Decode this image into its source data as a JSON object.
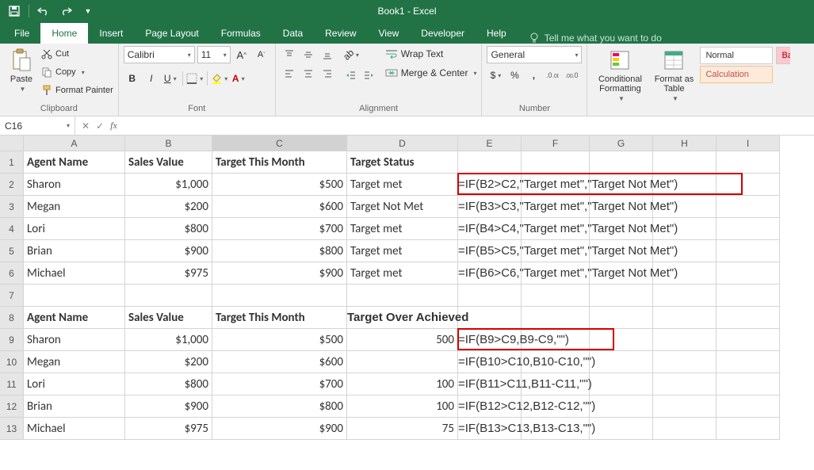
{
  "title": "Book1 - Excel",
  "tabs": [
    "File",
    "Home",
    "Insert",
    "Page Layout",
    "Formulas",
    "Data",
    "Review",
    "View",
    "Developer",
    "Help"
  ],
  "tellme": "Tell me what you want to do",
  "clipboard": {
    "cut": "Cut",
    "copy": "Copy",
    "painter": "Format Painter",
    "paste": "Paste",
    "label": "Clipboard"
  },
  "font": {
    "name": "Calibri",
    "size": "11",
    "label": "Font"
  },
  "alignment": {
    "wrap": "Wrap Text",
    "merge": "Merge & Center",
    "label": "Alignment"
  },
  "number": {
    "format": "General",
    "label": "Number"
  },
  "styles": {
    "cond": "Conditional Formatting",
    "table": "Format as Table",
    "normal": "Normal",
    "calc": "Calculation",
    "bad": "Ba"
  },
  "namebox": "C16",
  "chart_data": {
    "type": "table",
    "columns": [
      "",
      "A",
      "B",
      "C",
      "D",
      "E",
      "F",
      "G",
      "H",
      "I"
    ],
    "rows": [
      {
        "n": "1",
        "A": "Agent Name",
        "B": "Sales Value",
        "C": "Target This Month",
        "D": "Target Status",
        "E": "",
        "bold": true
      },
      {
        "n": "2",
        "A": "Sharon",
        "B": "$1,000",
        "C": "$500",
        "D": "Target met",
        "E": "=IF(B2>C2,\"Target met\",\"Target Not Met\")"
      },
      {
        "n": "3",
        "A": "Megan",
        "B": "$200",
        "C": "$600",
        "D": "Target Not Met",
        "E": "=IF(B3>C3,\"Target met\",\"Target Not Met\")"
      },
      {
        "n": "4",
        "A": "Lori",
        "B": "$800",
        "C": "$700",
        "D": "Target met",
        "E": "=IF(B4>C4,\"Target met\",\"Target Not Met\")"
      },
      {
        "n": "5",
        "A": "Brian",
        "B": "$900",
        "C": "$800",
        "D": "Target met",
        "E": "=IF(B5>C5,\"Target met\",\"Target Not Met\")"
      },
      {
        "n": "6",
        "A": "Michael",
        "B": "$975",
        "C": "$900",
        "D": "Target met",
        "E": "=IF(B6>C6,\"Target met\",\"Target Not Met\")"
      },
      {
        "n": "7",
        "A": "",
        "B": "",
        "C": "",
        "D": "",
        "E": ""
      },
      {
        "n": "8",
        "A": "Agent Name",
        "B": "Sales Value",
        "C": "Target This Month",
        "D": "Target Over Achieved",
        "E": "",
        "bold": true
      },
      {
        "n": "9",
        "A": "Sharon",
        "B": "$1,000",
        "C": "$500",
        "D": "500",
        "E": "=IF(B9>C9,B9-C9,\"\")"
      },
      {
        "n": "10",
        "A": "Megan",
        "B": "$200",
        "C": "$600",
        "D": "",
        "E": "=IF(B10>C10,B10-C10,\"\")"
      },
      {
        "n": "11",
        "A": "Lori",
        "B": "$800",
        "C": "$700",
        "D": "100",
        "E": "=IF(B11>C11,B11-C11,\"\")"
      },
      {
        "n": "12",
        "A": "Brian",
        "B": "$900",
        "C": "$800",
        "D": "100",
        "E": "=IF(B12>C12,B12-C12,\"\")"
      },
      {
        "n": "13",
        "A": "Michael",
        "B": "$975",
        "C": "$900",
        "D": "75",
        "E": "=IF(B13>C13,B13-C13,\"\")"
      }
    ]
  }
}
